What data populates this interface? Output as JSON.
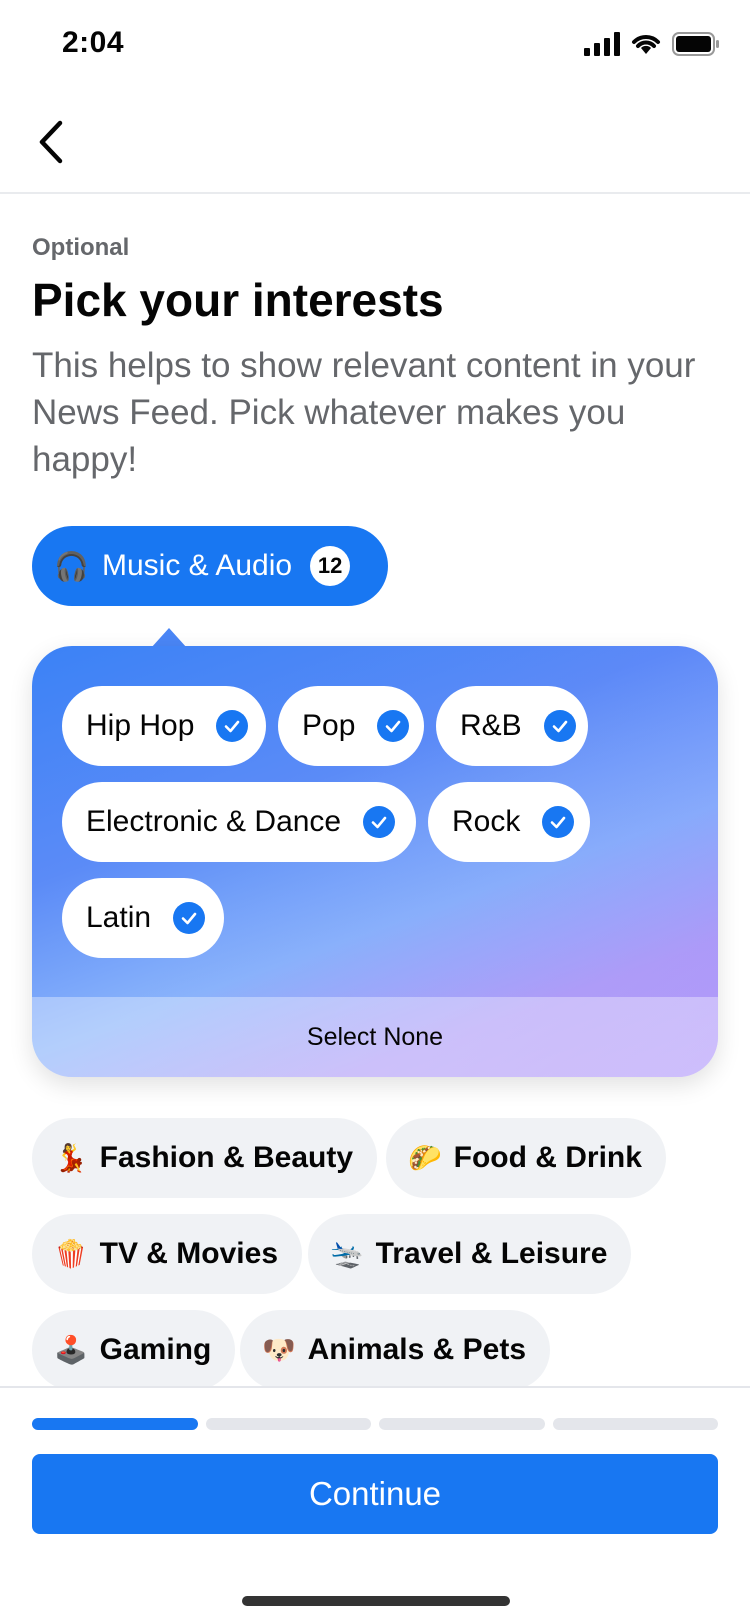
{
  "status_bar": {
    "time": "2:04"
  },
  "header": {
    "eyebrow": "Optional",
    "title": "Pick your interests",
    "subtitle": "This helps to show relevant content in your News Feed. Pick whatever makes you happy!"
  },
  "selected_category": {
    "emoji": "🎧",
    "label": "Music & Audio",
    "count": "12",
    "icon": "headphones-icon"
  },
  "subcategories": [
    {
      "label": "Hip Hop",
      "checked": true
    },
    {
      "label": "Pop",
      "checked": true
    },
    {
      "label": "R&B",
      "checked": true
    },
    {
      "label": "Electronic & Dance",
      "checked": true
    },
    {
      "label": "Rock",
      "checked": true
    },
    {
      "label": "Latin",
      "checked": true
    }
  ],
  "select_none_label": "Select None",
  "categories": [
    {
      "emoji": "💃",
      "label": "Fashion & Beauty",
      "icon": "dancer-icon"
    },
    {
      "emoji": "🌮",
      "label": "Food & Drink",
      "icon": "taco-icon"
    },
    {
      "emoji": "🍿",
      "label": "TV & Movies",
      "icon": "popcorn-icon"
    },
    {
      "emoji": "🛬",
      "label": "Travel & Leisure",
      "icon": "airplane-icon"
    },
    {
      "emoji": "🕹️",
      "label": "Gaming",
      "icon": "joystick-icon"
    },
    {
      "emoji": "🐶",
      "label": "Animals & Pets",
      "icon": "dog-icon"
    }
  ],
  "progress": {
    "current_step": 1,
    "total_steps": 4
  },
  "continue_label": "Continue",
  "colors": {
    "accent": "#1877f2",
    "chip_bg": "#f0f2f5",
    "secondary_text": "#65676b"
  }
}
